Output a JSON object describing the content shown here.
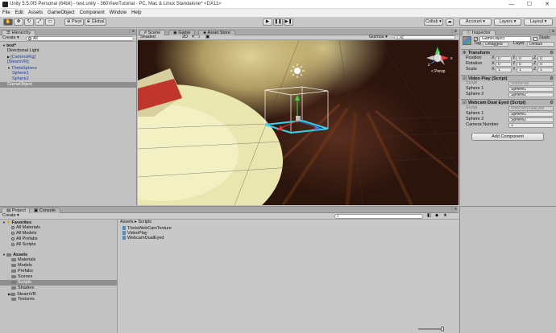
{
  "window": {
    "title": "Unity 5.5.0f3 Personal (64bit) - test.unity - 360ViewTutorial - PC, Mac & Linux Standalone* <DX11>",
    "minimize": "—",
    "maximize": "☐",
    "close": "✕"
  },
  "menu": [
    "File",
    "Edit",
    "Assets",
    "GameObject",
    "Component",
    "Window",
    "Help"
  ],
  "toolbar": {
    "pivot": "Pivot",
    "global": "Global",
    "play": "▶",
    "pause": "❚❚",
    "step": "▶❚",
    "collab": "Collab ▾",
    "account": "Account ▾",
    "layers": "Layers ▾",
    "layout": "Layout ▾"
  },
  "hierarchy": {
    "tab": "Hierarchy",
    "create": "Create ▾",
    "search_prefix": "All",
    "items": [
      {
        "label": "test*",
        "indent": 0,
        "bold": true,
        "arrow": "▼"
      },
      {
        "label": "Directional Light",
        "indent": 1
      },
      {
        "label": "[CameraRig]",
        "indent": 1,
        "blue": true,
        "arrow": "▶"
      },
      {
        "label": "[SteamVR]",
        "indent": 1,
        "blue": true
      },
      {
        "label": "ThetaSphere",
        "indent": 1,
        "blue": true,
        "arrow": "▼"
      },
      {
        "label": "Sphere1",
        "indent": 2,
        "blue": true
      },
      {
        "label": "Sphere2",
        "indent": 2,
        "blue": true
      },
      {
        "label": "GameObject",
        "indent": 1,
        "selected": true
      }
    ]
  },
  "scene": {
    "tabs": [
      "Scene",
      "Game",
      "Asset Store"
    ],
    "shading": "Shaded",
    "mode_2d": "2D",
    "gizmos": "Gizmos ▾",
    "search_prefix": "All",
    "persp": "< Persp",
    "axis_x": "x",
    "axis_y": "y",
    "axis_z": "z"
  },
  "inspector": {
    "tab": "Inspector",
    "object_name": "GameObject",
    "static": "Static",
    "tag_label": "Tag",
    "tag_value": "Untagged",
    "layer_label": "Layer",
    "layer_value": "Default",
    "transform": {
      "title": "Transform",
      "rows": [
        {
          "label": "Position",
          "x": "0",
          "y": "0",
          "z": "0"
        },
        {
          "label": "Rotation",
          "x": "0",
          "y": "0",
          "z": "0"
        },
        {
          "label": "Scale",
          "x": "1",
          "y": "1",
          "z": "1"
        }
      ]
    },
    "video_play": {
      "title": "Video Play (Script)",
      "script_label": "Script",
      "script_value": "VideoPlay",
      "sphere1_label": "Sphere 1",
      "sphere1_value": "Sphere1",
      "sphere2_label": "Sphere 2",
      "sphere2_value": "Sphere2"
    },
    "webcam": {
      "title": "Webcam Dual Eyed (Script)",
      "script_label": "Script",
      "script_value": "WebcamDualEyed",
      "sphere1_label": "Sphere 1",
      "sphere1_value": "Sphere1",
      "sphere2_label": "Sphere 2",
      "sphere2_value": "Sphere2",
      "camera_label": "Camera Number",
      "camera_value": "1"
    },
    "add_component": "Add Component"
  },
  "project": {
    "tabs": [
      "Project",
      "Console"
    ],
    "create": "Create ▾",
    "favorites_title": "Favorites",
    "favorites": [
      "All Materials",
      "All Models",
      "All Prefabs",
      "All Scripts"
    ],
    "assets_title": "Assets",
    "asset_folders": [
      {
        "label": "Materials"
      },
      {
        "label": "Models"
      },
      {
        "label": "Prefabs"
      },
      {
        "label": "Scenes"
      },
      {
        "label": "Scripts",
        "selected": true
      },
      {
        "label": "Shaders"
      },
      {
        "label": "SteamVR",
        "arrow": "▶"
      },
      {
        "label": "Textures"
      }
    ],
    "breadcrumb": "Assets ▸ Scripts",
    "files": [
      "ThetaWebCamTexture",
      "VideoPlay",
      "WebcamDualEyed"
    ]
  },
  "colors": {
    "selection": "#8f8f8f",
    "blue_link": "#1a3fa8",
    "gizmo_cyan": "#35d3f0"
  }
}
